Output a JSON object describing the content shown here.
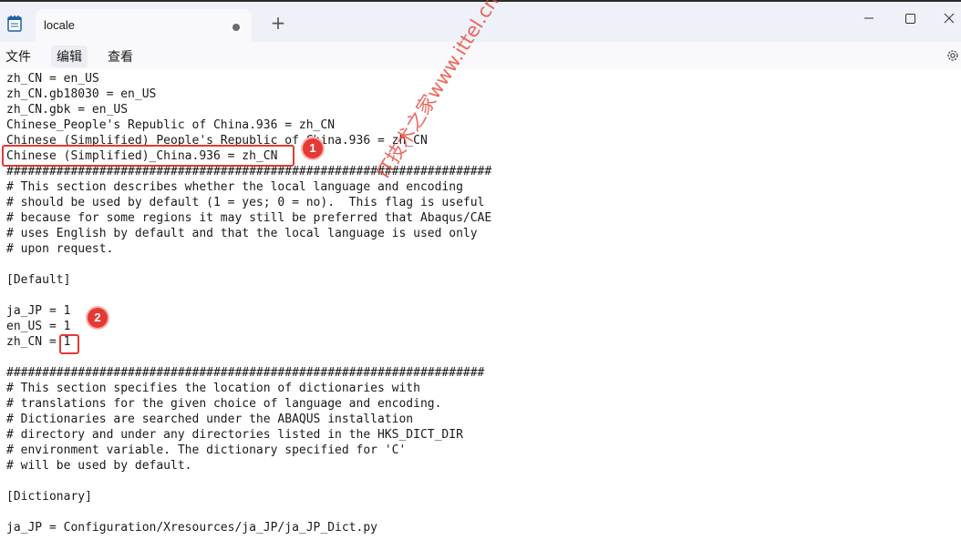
{
  "window": {
    "tab_title": "locale",
    "new_tab_glyph": "+",
    "icons": {
      "app": "notepad-icon",
      "minimize": "minimize-icon",
      "maximize": "maximize-icon",
      "close": "close-icon",
      "settings": "gear-icon"
    }
  },
  "menu": {
    "items": [
      "文件",
      "编辑",
      "查看"
    ]
  },
  "editor": {
    "lines": [
      "zh_CN = en_US",
      "zh_CN.gb18030 = en_US",
      "zh_CN.gbk = en_US",
      "Chinese_People's Republic of China.936 = zh_CN",
      "Chinese (Simplified)_People's Republic of China.936 = zh_CN",
      "Chinese (Simplified)_China.936 = zh_CN",
      "####################################################################",
      "# This section describes whether the local language and encoding",
      "# should be used by default (1 = yes; 0 = no).  This flag is useful",
      "# because for some regions it may still be preferred that Abaqus/CAE",
      "# uses English by default and that the local language is used only",
      "# upon request.",
      "",
      "[Default]",
      "",
      "ja_JP = 1",
      "en_US = 1",
      "zh_CN = 1",
      "",
      "###################################################################",
      "# This section specifies the location of dictionaries with",
      "# translations for the given choice of language and encoding.",
      "# Dictionaries are searched under the ABAQUS installation",
      "# directory and under any directories listed in the HKS_DICT_DIR",
      "# environment variable. The dictionary specified for 'C'",
      "# will be used by default.",
      "",
      "[Dictionary]",
      "",
      "ja_JP = Configuration/Xresources/ja_JP/ja_JP_Dict.py"
    ]
  },
  "annotations": {
    "badge_1": "1",
    "badge_2": "2",
    "accent_color": "#e53935"
  },
  "watermark": "IT技术之家www.ittel.cn"
}
